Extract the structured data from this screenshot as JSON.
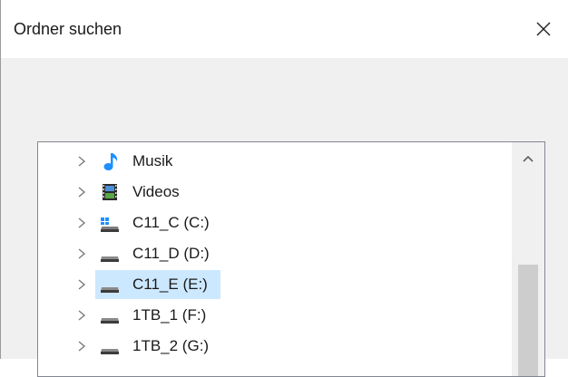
{
  "dialog": {
    "title": "Ordner suchen",
    "close_glyph": "✕"
  },
  "tree": {
    "items": [
      {
        "label": "Musik",
        "icon": "music-icon",
        "selected": false
      },
      {
        "label": "Videos",
        "icon": "video-icon",
        "selected": false
      },
      {
        "label": "C11_C (C:)",
        "icon": "system-drive-icon",
        "selected": false
      },
      {
        "label": "C11_D (D:)",
        "icon": "drive-icon",
        "selected": false
      },
      {
        "label": "C11_E (E:)",
        "icon": "drive-icon",
        "selected": true
      },
      {
        "label": "1TB_1 (F:)",
        "icon": "drive-icon",
        "selected": false
      },
      {
        "label": "1TB_2 (G:)",
        "icon": "drive-icon",
        "selected": false
      }
    ]
  },
  "colors": {
    "selection": "#cce8ff",
    "music_blue": "#1e90ff",
    "scroll_thumb": "#cdcdcd"
  }
}
